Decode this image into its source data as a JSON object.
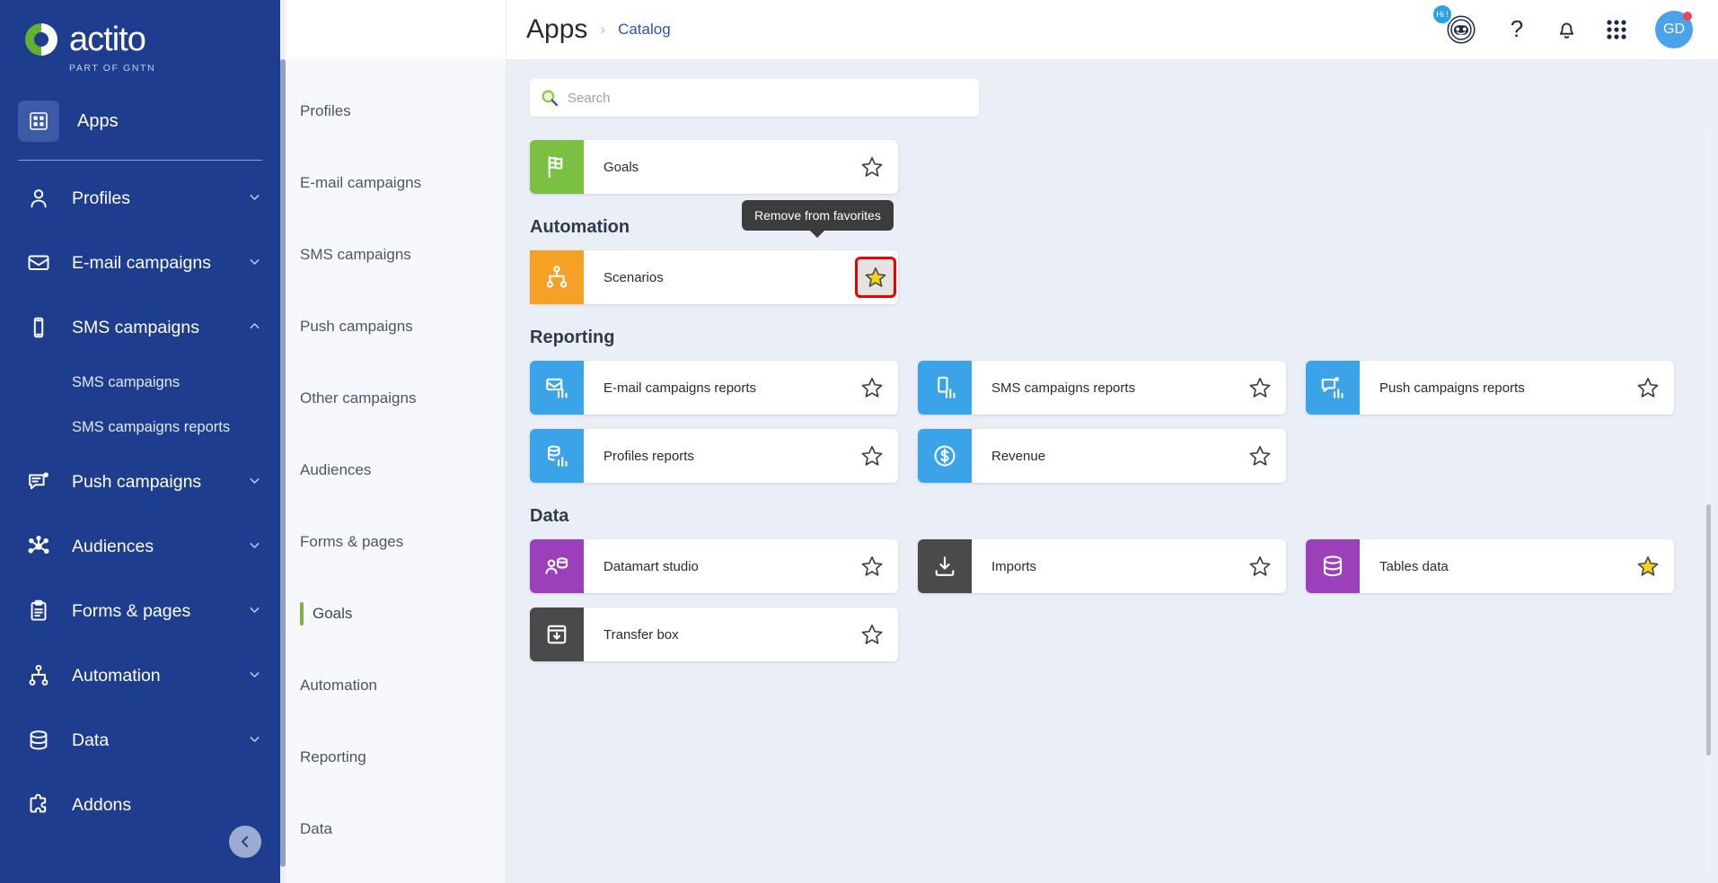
{
  "brand": {
    "name": "actito",
    "tagline": "PART OF GNTN",
    "logo_green": "#62b22e",
    "sidebar_bg": "#1e3d8f"
  },
  "sidebar": {
    "apps_label": "Apps",
    "apps_icon": "apps-grid-icon",
    "collapse_icon": "chevron-left-icon",
    "items": [
      {
        "label": "Profiles",
        "icon": "user-icon",
        "chevron": "chevron-down-icon",
        "expanded": false
      },
      {
        "label": "E-mail campaigns",
        "icon": "envelope-icon",
        "chevron": "chevron-down-icon",
        "expanded": false
      },
      {
        "label": "SMS campaigns",
        "icon": "mobile-icon",
        "chevron": "chevron-up-icon",
        "expanded": true,
        "subitems": [
          "SMS campaigns",
          "SMS campaigns reports"
        ]
      },
      {
        "label": "Push campaigns",
        "icon": "push-message-icon",
        "chevron": "chevron-down-icon",
        "expanded": false
      },
      {
        "label": "Audiences",
        "icon": "network-nodes-icon",
        "chevron": "chevron-down-icon",
        "expanded": false
      },
      {
        "label": "Forms & pages",
        "icon": "clipboard-icon",
        "chevron": "chevron-down-icon",
        "expanded": false
      },
      {
        "label": "Automation",
        "icon": "sitemap-icon",
        "chevron": "chevron-down-icon",
        "expanded": false
      },
      {
        "label": "Data",
        "icon": "database-icon",
        "chevron": "chevron-down-icon",
        "expanded": false
      },
      {
        "label": "Addons",
        "icon": "puzzle-piece-icon",
        "chevron": "",
        "expanded": false
      }
    ]
  },
  "category_panel": {
    "active_marker_color": "#7cb342",
    "items": [
      {
        "label": "Profiles",
        "active": false
      },
      {
        "label": "E-mail campaigns",
        "active": false
      },
      {
        "label": "SMS campaigns",
        "active": false
      },
      {
        "label": "Push campaigns",
        "active": false
      },
      {
        "label": "Other campaigns",
        "active": false
      },
      {
        "label": "Audiences",
        "active": false
      },
      {
        "label": "Forms & pages",
        "active": false
      },
      {
        "label": "Goals",
        "active": true
      },
      {
        "label": "Automation",
        "active": false
      },
      {
        "label": "Reporting",
        "active": false
      },
      {
        "label": "Data",
        "active": false
      }
    ]
  },
  "header": {
    "title": "Apps",
    "separator": "›",
    "breadcrumb_link": "Catalog",
    "assistant_icon": "chatbot-icon",
    "assistant_badge": "Hi !",
    "help_icon": "question-mark-icon",
    "notifications_icon": "bell-icon",
    "apps_grid_icon": "grid-nine-dots-icon",
    "avatar_initials": "GD",
    "avatar_color": "#4aa3e8",
    "avatar_dot_color": "#f4405f"
  },
  "search": {
    "placeholder": "Search",
    "value": "",
    "icon": "search-icon",
    "icon_color": "#8cc63f"
  },
  "tooltip": {
    "text": "Remove from favorites",
    "bg": "#3c3c3c"
  },
  "highlight": {
    "border_color": "#ef0000"
  },
  "sections": [
    {
      "title": "",
      "cards": [
        {
          "label": "Goals",
          "icon": "checkered-flag-icon",
          "tile_color": "#7ac143",
          "favorite": false,
          "highlighted": false
        }
      ]
    },
    {
      "title": "Automation",
      "cards": [
        {
          "label": "Scenarios",
          "icon": "sitemap-icon",
          "tile_color": "#f5a126",
          "favorite": true,
          "highlighted": true
        }
      ]
    },
    {
      "title": "Reporting",
      "cards": [
        {
          "label": "E-mail campaigns reports",
          "icon": "envelope-chart-icon",
          "tile_color": "#3ba3e8",
          "favorite": false,
          "highlighted": false
        },
        {
          "label": "SMS campaigns reports",
          "icon": "mobile-chart-icon",
          "tile_color": "#3ba3e8",
          "favorite": false,
          "highlighted": false
        },
        {
          "label": "Push campaigns reports",
          "icon": "push-chart-icon",
          "tile_color": "#3ba3e8",
          "favorite": false,
          "highlighted": false
        },
        {
          "label": "Profiles reports",
          "icon": "profiles-chart-icon",
          "tile_color": "#3ba3e8",
          "favorite": false,
          "highlighted": false
        },
        {
          "label": "Revenue",
          "icon": "dollar-coin-icon",
          "tile_color": "#3ba3e8",
          "favorite": false,
          "highlighted": false
        }
      ]
    },
    {
      "title": "Data",
      "cards": [
        {
          "label": "Datamart studio",
          "icon": "datamart-icon",
          "tile_color": "#9c3fbb",
          "favorite": false,
          "highlighted": false
        },
        {
          "label": "Imports",
          "icon": "download-box-icon",
          "tile_color": "#4a4a4a",
          "favorite": false,
          "highlighted": false
        },
        {
          "label": "Tables data",
          "icon": "database-icon",
          "tile_color": "#9c3fbb",
          "favorite": true,
          "highlighted": false
        },
        {
          "label": "Transfer box",
          "icon": "transfer-box-icon",
          "tile_color": "#4a4a4a",
          "favorite": false,
          "highlighted": false
        }
      ]
    }
  ],
  "scrollbars": {
    "main_visible": true,
    "category_visible": true
  }
}
